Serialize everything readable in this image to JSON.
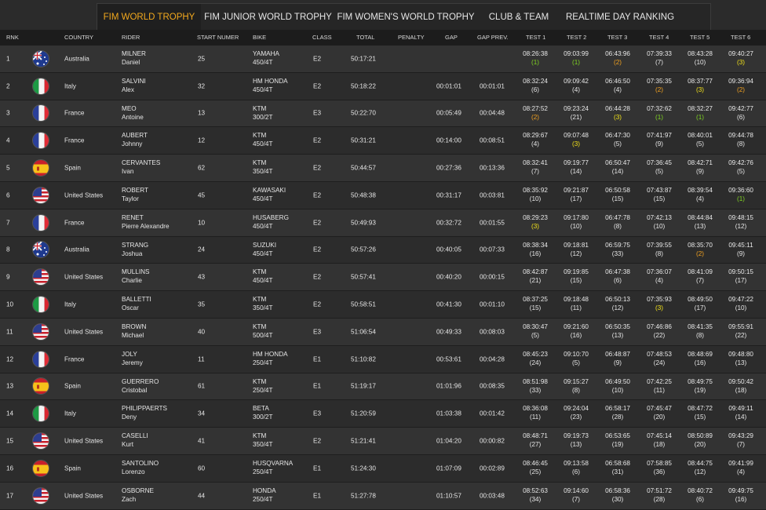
{
  "tabs": [
    {
      "label": "FIM WORLD TROPHY",
      "active": true
    },
    {
      "label": "FIM JUNIOR WORLD TROPHY",
      "active": false
    },
    {
      "label": "FIM WOMEN'S WORLD TROPHY",
      "active": false
    },
    {
      "label": "CLUB & TEAM",
      "active": false
    },
    {
      "label": "REALTIME DAY RANKING",
      "active": false
    }
  ],
  "columns": {
    "rank": "RNK",
    "country": "COUNTRY",
    "rider": "RIDER",
    "start": "START NUMER",
    "bike": "BIKE",
    "class": "CLASS",
    "total": "TOTAL",
    "penalty": "PENALTY",
    "gap": "GAP",
    "gap_prev": "GAP PREV.",
    "tests": [
      "TEST 1",
      "TEST 2",
      "TEST 3",
      "TEST 4",
      "TEST 5",
      "TEST 6"
    ]
  },
  "rows": [
    {
      "rank": "1",
      "flag": "au",
      "country": "Australia",
      "last": "MILNER",
      "first": "Daniel",
      "start": "25",
      "bike": "YAMAHA",
      "engine": "450/4T",
      "cls": "E2",
      "total": "50:17:21",
      "penalty": "",
      "gap": "",
      "gap_prev": "",
      "tests": [
        [
          "08:26:38",
          "(1)"
        ],
        [
          "09:03:99",
          "(1)"
        ],
        [
          "06:43:96",
          "(2)"
        ],
        [
          "07:39:33",
          "(7)"
        ],
        [
          "08:43:28",
          "(10)"
        ],
        [
          "09:40:27",
          "(3)"
        ]
      ]
    },
    {
      "rank": "2",
      "flag": "it",
      "country": "Italy",
      "last": "SALVINI",
      "first": "Alex",
      "start": "32",
      "bike": "HM HONDA",
      "engine": "450/4T",
      "cls": "E2",
      "total": "50:18:22",
      "penalty": "",
      "gap": "00:01:01",
      "gap_prev": "00:01:01",
      "tests": [
        [
          "08:32:24",
          "(6)"
        ],
        [
          "09:09:42",
          "(4)"
        ],
        [
          "06:46:50",
          "(4)"
        ],
        [
          "07:35:35",
          "(2)"
        ],
        [
          "08:37:77",
          "(3)"
        ],
        [
          "09:36:94",
          "(2)"
        ]
      ]
    },
    {
      "rank": "3",
      "flag": "fr",
      "country": "France",
      "last": "MEO",
      "first": "Antoine",
      "start": "13",
      "bike": "KTM",
      "engine": "300/2T",
      "cls": "E3",
      "total": "50:22:70",
      "penalty": "",
      "gap": "00:05:49",
      "gap_prev": "00:04:48",
      "tests": [
        [
          "08:27:52",
          "(2)"
        ],
        [
          "09:23:24",
          "(21)"
        ],
        [
          "06:44:28",
          "(3)"
        ],
        [
          "07:32:62",
          "(1)"
        ],
        [
          "08:32:27",
          "(1)"
        ],
        [
          "09:42:77",
          "(6)"
        ]
      ]
    },
    {
      "rank": "4",
      "flag": "fr",
      "country": "France",
      "last": "AUBERT",
      "first": "Johnny",
      "start": "12",
      "bike": "KTM",
      "engine": "450/4T",
      "cls": "E2",
      "total": "50:31:21",
      "penalty": "",
      "gap": "00:14:00",
      "gap_prev": "00:08:51",
      "tests": [
        [
          "08:29:67",
          "(4)"
        ],
        [
          "09:07:48",
          "(3)"
        ],
        [
          "06:47:30",
          "(5)"
        ],
        [
          "07:41:97",
          "(9)"
        ],
        [
          "08:40:01",
          "(5)"
        ],
        [
          "09:44:78",
          "(8)"
        ]
      ]
    },
    {
      "rank": "5",
      "flag": "es",
      "country": "Spain",
      "last": "CERVANTES",
      "first": "Ivan",
      "start": "62",
      "bike": "KTM",
      "engine": "350/4T",
      "cls": "E2",
      "total": "50:44:57",
      "penalty": "",
      "gap": "00:27:36",
      "gap_prev": "00:13:36",
      "tests": [
        [
          "08:32:41",
          "(7)"
        ],
        [
          "09:19:77",
          "(14)"
        ],
        [
          "06:50:47",
          "(14)"
        ],
        [
          "07:36:45",
          "(5)"
        ],
        [
          "08:42:71",
          "(9)"
        ],
        [
          "09:42:76",
          "(5)"
        ]
      ]
    },
    {
      "rank": "6",
      "flag": "us",
      "country": "United States",
      "last": "ROBERT",
      "first": "Taylor",
      "start": "45",
      "bike": "KAWASAKI",
      "engine": "450/4T",
      "cls": "E2",
      "total": "50:48:38",
      "penalty": "",
      "gap": "00:31:17",
      "gap_prev": "00:03:81",
      "tests": [
        [
          "08:35:92",
          "(10)"
        ],
        [
          "09:21:87",
          "(17)"
        ],
        [
          "06:50:58",
          "(15)"
        ],
        [
          "07:43:87",
          "(15)"
        ],
        [
          "08:39:54",
          "(4)"
        ],
        [
          "09:36:60",
          "(1)"
        ]
      ]
    },
    {
      "rank": "7",
      "flag": "fr",
      "country": "France",
      "last": "RENET",
      "first": "Pierre Alexandre",
      "start": "10",
      "bike": "HUSABERG",
      "engine": "450/4T",
      "cls": "E2",
      "total": "50:49:93",
      "penalty": "",
      "gap": "00:32:72",
      "gap_prev": "00:01:55",
      "tests": [
        [
          "08:29:23",
          "(3)"
        ],
        [
          "09:17:80",
          "(10)"
        ],
        [
          "06:47:78",
          "(8)"
        ],
        [
          "07:42:13",
          "(10)"
        ],
        [
          "08:44:84",
          "(13)"
        ],
        [
          "09:48:15",
          "(12)"
        ]
      ]
    },
    {
      "rank": "8",
      "flag": "au",
      "country": "Australia",
      "last": "STRANG",
      "first": "Joshua",
      "start": "24",
      "bike": "SUZUKI",
      "engine": "450/4T",
      "cls": "E2",
      "total": "50:57:26",
      "penalty": "",
      "gap": "00:40:05",
      "gap_prev": "00:07:33",
      "tests": [
        [
          "08:38:34",
          "(16)"
        ],
        [
          "09:18:81",
          "(12)"
        ],
        [
          "06:59:75",
          "(33)"
        ],
        [
          "07:39:55",
          "(8)"
        ],
        [
          "08:35:70",
          "(2)"
        ],
        [
          "09:45:11",
          "(9)"
        ]
      ]
    },
    {
      "rank": "9",
      "flag": "us",
      "country": "United States",
      "last": "MULLINS",
      "first": "Charlie",
      "start": "43",
      "bike": "KTM",
      "engine": "450/4T",
      "cls": "E2",
      "total": "50:57:41",
      "penalty": "",
      "gap": "00:40:20",
      "gap_prev": "00:00:15",
      "tests": [
        [
          "08:42:87",
          "(21)"
        ],
        [
          "09:19:85",
          "(15)"
        ],
        [
          "06:47:38",
          "(6)"
        ],
        [
          "07:36:07",
          "(4)"
        ],
        [
          "08:41:09",
          "(7)"
        ],
        [
          "09:50:15",
          "(17)"
        ]
      ]
    },
    {
      "rank": "10",
      "flag": "it",
      "country": "Italy",
      "last": "BALLETTI",
      "first": "Oscar",
      "start": "35",
      "bike": "KTM",
      "engine": "350/4T",
      "cls": "E2",
      "total": "50:58:51",
      "penalty": "",
      "gap": "00:41:30",
      "gap_prev": "00:01:10",
      "tests": [
        [
          "08:37:25",
          "(15)"
        ],
        [
          "09:18:48",
          "(11)"
        ],
        [
          "06:50:13",
          "(12)"
        ],
        [
          "07:35:93",
          "(3)"
        ],
        [
          "08:49:50",
          "(17)"
        ],
        [
          "09:47:22",
          "(10)"
        ]
      ]
    },
    {
      "rank": "11",
      "flag": "us",
      "country": "United States",
      "last": "BROWN",
      "first": "Michael",
      "start": "40",
      "bike": "KTM",
      "engine": "500/4T",
      "cls": "E3",
      "total": "51:06:54",
      "penalty": "",
      "gap": "00:49:33",
      "gap_prev": "00:08:03",
      "tests": [
        [
          "08:30:47",
          "(5)"
        ],
        [
          "09:21:60",
          "(16)"
        ],
        [
          "06:50:35",
          "(13)"
        ],
        [
          "07:46:86",
          "(22)"
        ],
        [
          "08:41:35",
          "(8)"
        ],
        [
          "09:55:91",
          "(22)"
        ]
      ]
    },
    {
      "rank": "12",
      "flag": "fr",
      "country": "France",
      "last": "JOLY",
      "first": "Jeremy",
      "start": "11",
      "bike": "HM HONDA",
      "engine": "250/4T",
      "cls": "E1",
      "total": "51:10:82",
      "penalty": "",
      "gap": "00:53:61",
      "gap_prev": "00:04:28",
      "tests": [
        [
          "08:45:23",
          "(24)"
        ],
        [
          "09:10:70",
          "(5)"
        ],
        [
          "06:48:87",
          "(9)"
        ],
        [
          "07:48:53",
          "(24)"
        ],
        [
          "08:48:69",
          "(16)"
        ],
        [
          "09:48:80",
          "(13)"
        ]
      ]
    },
    {
      "rank": "13",
      "flag": "es",
      "country": "Spain",
      "last": "GUERRERO",
      "first": "Cristobal",
      "start": "61",
      "bike": "KTM",
      "engine": "250/4T",
      "cls": "E1",
      "total": "51:19:17",
      "penalty": "",
      "gap": "01:01:96",
      "gap_prev": "00:08:35",
      "tests": [
        [
          "08:51:98",
          "(33)"
        ],
        [
          "09:15:27",
          "(8)"
        ],
        [
          "06:49:50",
          "(10)"
        ],
        [
          "07:42:25",
          "(11)"
        ],
        [
          "08:49:75",
          "(19)"
        ],
        [
          "09:50:42",
          "(18)"
        ]
      ]
    },
    {
      "rank": "14",
      "flag": "it",
      "country": "Italy",
      "last": "PHILIPPAERTS",
      "first": "Deny",
      "start": "34",
      "bike": "BETA",
      "engine": "300/2T",
      "cls": "E3",
      "total": "51:20:59",
      "penalty": "",
      "gap": "01:03:38",
      "gap_prev": "00:01:42",
      "tests": [
        [
          "08:36:08",
          "(11)"
        ],
        [
          "09:24:04",
          "(23)"
        ],
        [
          "06:58:17",
          "(28)"
        ],
        [
          "07:45:47",
          "(20)"
        ],
        [
          "08:47:72",
          "(15)"
        ],
        [
          "09:49:11",
          "(14)"
        ]
      ]
    },
    {
      "rank": "15",
      "flag": "us",
      "country": "United States",
      "last": "CASELLI",
      "first": "Kurt",
      "start": "41",
      "bike": "KTM",
      "engine": "350/4T",
      "cls": "E2",
      "total": "51:21:41",
      "penalty": "",
      "gap": "01:04:20",
      "gap_prev": "00:00:82",
      "tests": [
        [
          "08:48:71",
          "(27)"
        ],
        [
          "09:19:73",
          "(13)"
        ],
        [
          "06:53:65",
          "(19)"
        ],
        [
          "07:45:14",
          "(18)"
        ],
        [
          "08:50:89",
          "(20)"
        ],
        [
          "09:43:29",
          "(7)"
        ]
      ]
    },
    {
      "rank": "16",
      "flag": "es",
      "country": "Spain",
      "last": "SANTOLINO",
      "first": "Lorenzo",
      "start": "60",
      "bike": "HUSQVARNA",
      "engine": "250/4T",
      "cls": "E1",
      "total": "51:24:30",
      "penalty": "",
      "gap": "01:07:09",
      "gap_prev": "00:02:89",
      "tests": [
        [
          "08:46:45",
          "(25)"
        ],
        [
          "09:13:58",
          "(6)"
        ],
        [
          "06:58:68",
          "(31)"
        ],
        [
          "07:58:85",
          "(36)"
        ],
        [
          "08:44:75",
          "(12)"
        ],
        [
          "09:41:99",
          "(4)"
        ]
      ]
    },
    {
      "rank": "17",
      "flag": "us",
      "country": "United States",
      "last": "OSBORNE",
      "first": "Zach",
      "start": "44",
      "bike": "HONDA",
      "engine": "250/4T",
      "cls": "E1",
      "total": "51:27:78",
      "penalty": "",
      "gap": "01:10:57",
      "gap_prev": "00:03:48",
      "tests": [
        [
          "08:52:63",
          "(34)"
        ],
        [
          "09:14:60",
          "(7)"
        ],
        [
          "06:58:36",
          "(30)"
        ],
        [
          "07:51:72",
          "(28)"
        ],
        [
          "08:40:72",
          "(6)"
        ],
        [
          "09:49:75",
          "(16)"
        ]
      ]
    }
  ],
  "colors": {
    "active_tab": "#f2a81d",
    "first": "#7fd321",
    "second": "#f0a020",
    "third": "#f2e21a"
  }
}
